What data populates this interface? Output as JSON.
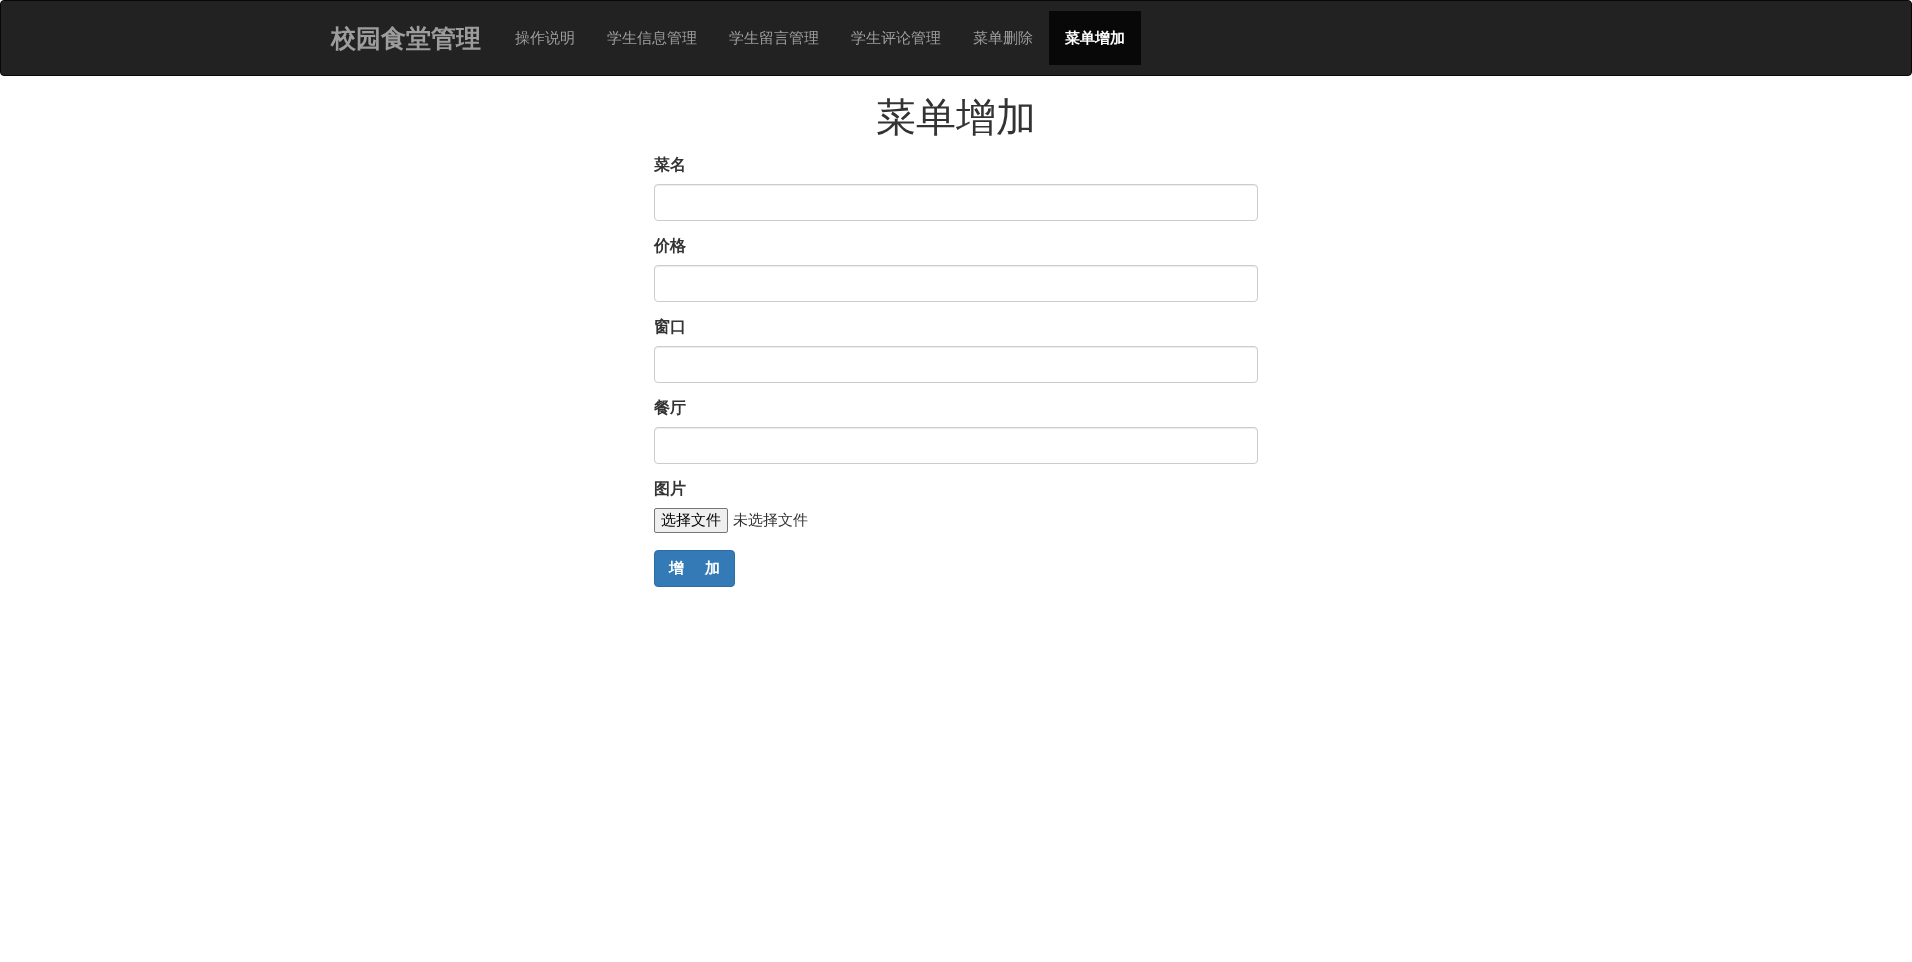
{
  "navbar": {
    "brand": "校园食堂管理",
    "items": [
      {
        "label": "操作说明",
        "selected": false
      },
      {
        "label": "学生信息管理",
        "selected": false
      },
      {
        "label": "学生留言管理",
        "selected": false
      },
      {
        "label": "学生评论管理",
        "selected": false
      },
      {
        "label": "菜单删除",
        "selected": false
      },
      {
        "label": "菜单增加",
        "selected": true
      }
    ]
  },
  "form": {
    "title": "菜单增加",
    "fields": [
      {
        "kind": "text",
        "label": "菜名"
      },
      {
        "kind": "text",
        "label": "价格"
      },
      {
        "kind": "text",
        "label": "窗口"
      },
      {
        "kind": "text",
        "label": "餐厅"
      },
      {
        "kind": "file",
        "label": "图片",
        "button": "选择文件",
        "status": "未选择文件"
      }
    ],
    "submit": "增    加"
  }
}
